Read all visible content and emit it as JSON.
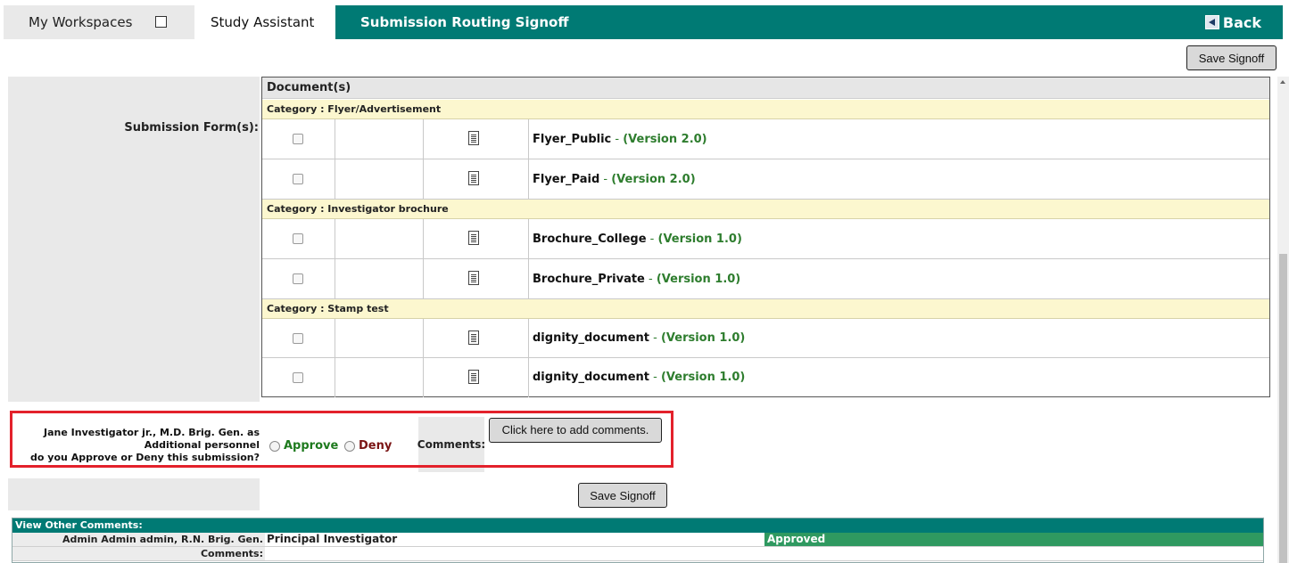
{
  "header": {
    "workspaces_label": "My Workspaces",
    "study_assistant_label": "Study Assistant",
    "title": "Submission Routing Signoff",
    "back_label": "Back"
  },
  "buttons": {
    "save_signoff": "Save Signoff",
    "add_comments": "Click here to add comments."
  },
  "form": {
    "submission_forms_label": "Submission Form(s):",
    "documents_header": "Document(s)",
    "categories": [
      {
        "label": "Category : Flyer/Advertisement",
        "docs": [
          {
            "name": "Flyer_Public",
            "version": "(Version 2.0)"
          },
          {
            "name": "Flyer_Paid",
            "version": "(Version 2.0)"
          }
        ]
      },
      {
        "label": "Category : Investigator brochure",
        "docs": [
          {
            "name": "Brochure_College",
            "version": "(Version 1.0)"
          },
          {
            "name": "Brochure_Private",
            "version": "(Version 1.0)"
          }
        ]
      },
      {
        "label": "Category : Stamp test",
        "docs": [
          {
            "name": "dignity_document",
            "version": "(Version 1.0)"
          },
          {
            "name": "dignity_document",
            "version": "(Version 1.0)"
          }
        ]
      }
    ],
    "separator": " - "
  },
  "approval": {
    "line1": "Jane Investigator jr., M.D. Brig. Gen. as",
    "line2": "Additional personnel",
    "line3": "do you Approve or Deny this submission?",
    "approve": "Approve",
    "deny": "Deny",
    "comments_label": "Comments:"
  },
  "other_comments": {
    "header": "View Other Comments:",
    "reviewer": "Admin Admin admin, R.N. Brig. Gen.",
    "role": "Principal Investigator",
    "status": "Approved",
    "comments_label": "Comments:"
  },
  "colors": {
    "brand_teal": "#007a74",
    "approved_green": "#2f9960",
    "highlight_red": "#e3212b",
    "category_bg": "#fcf7cf"
  }
}
